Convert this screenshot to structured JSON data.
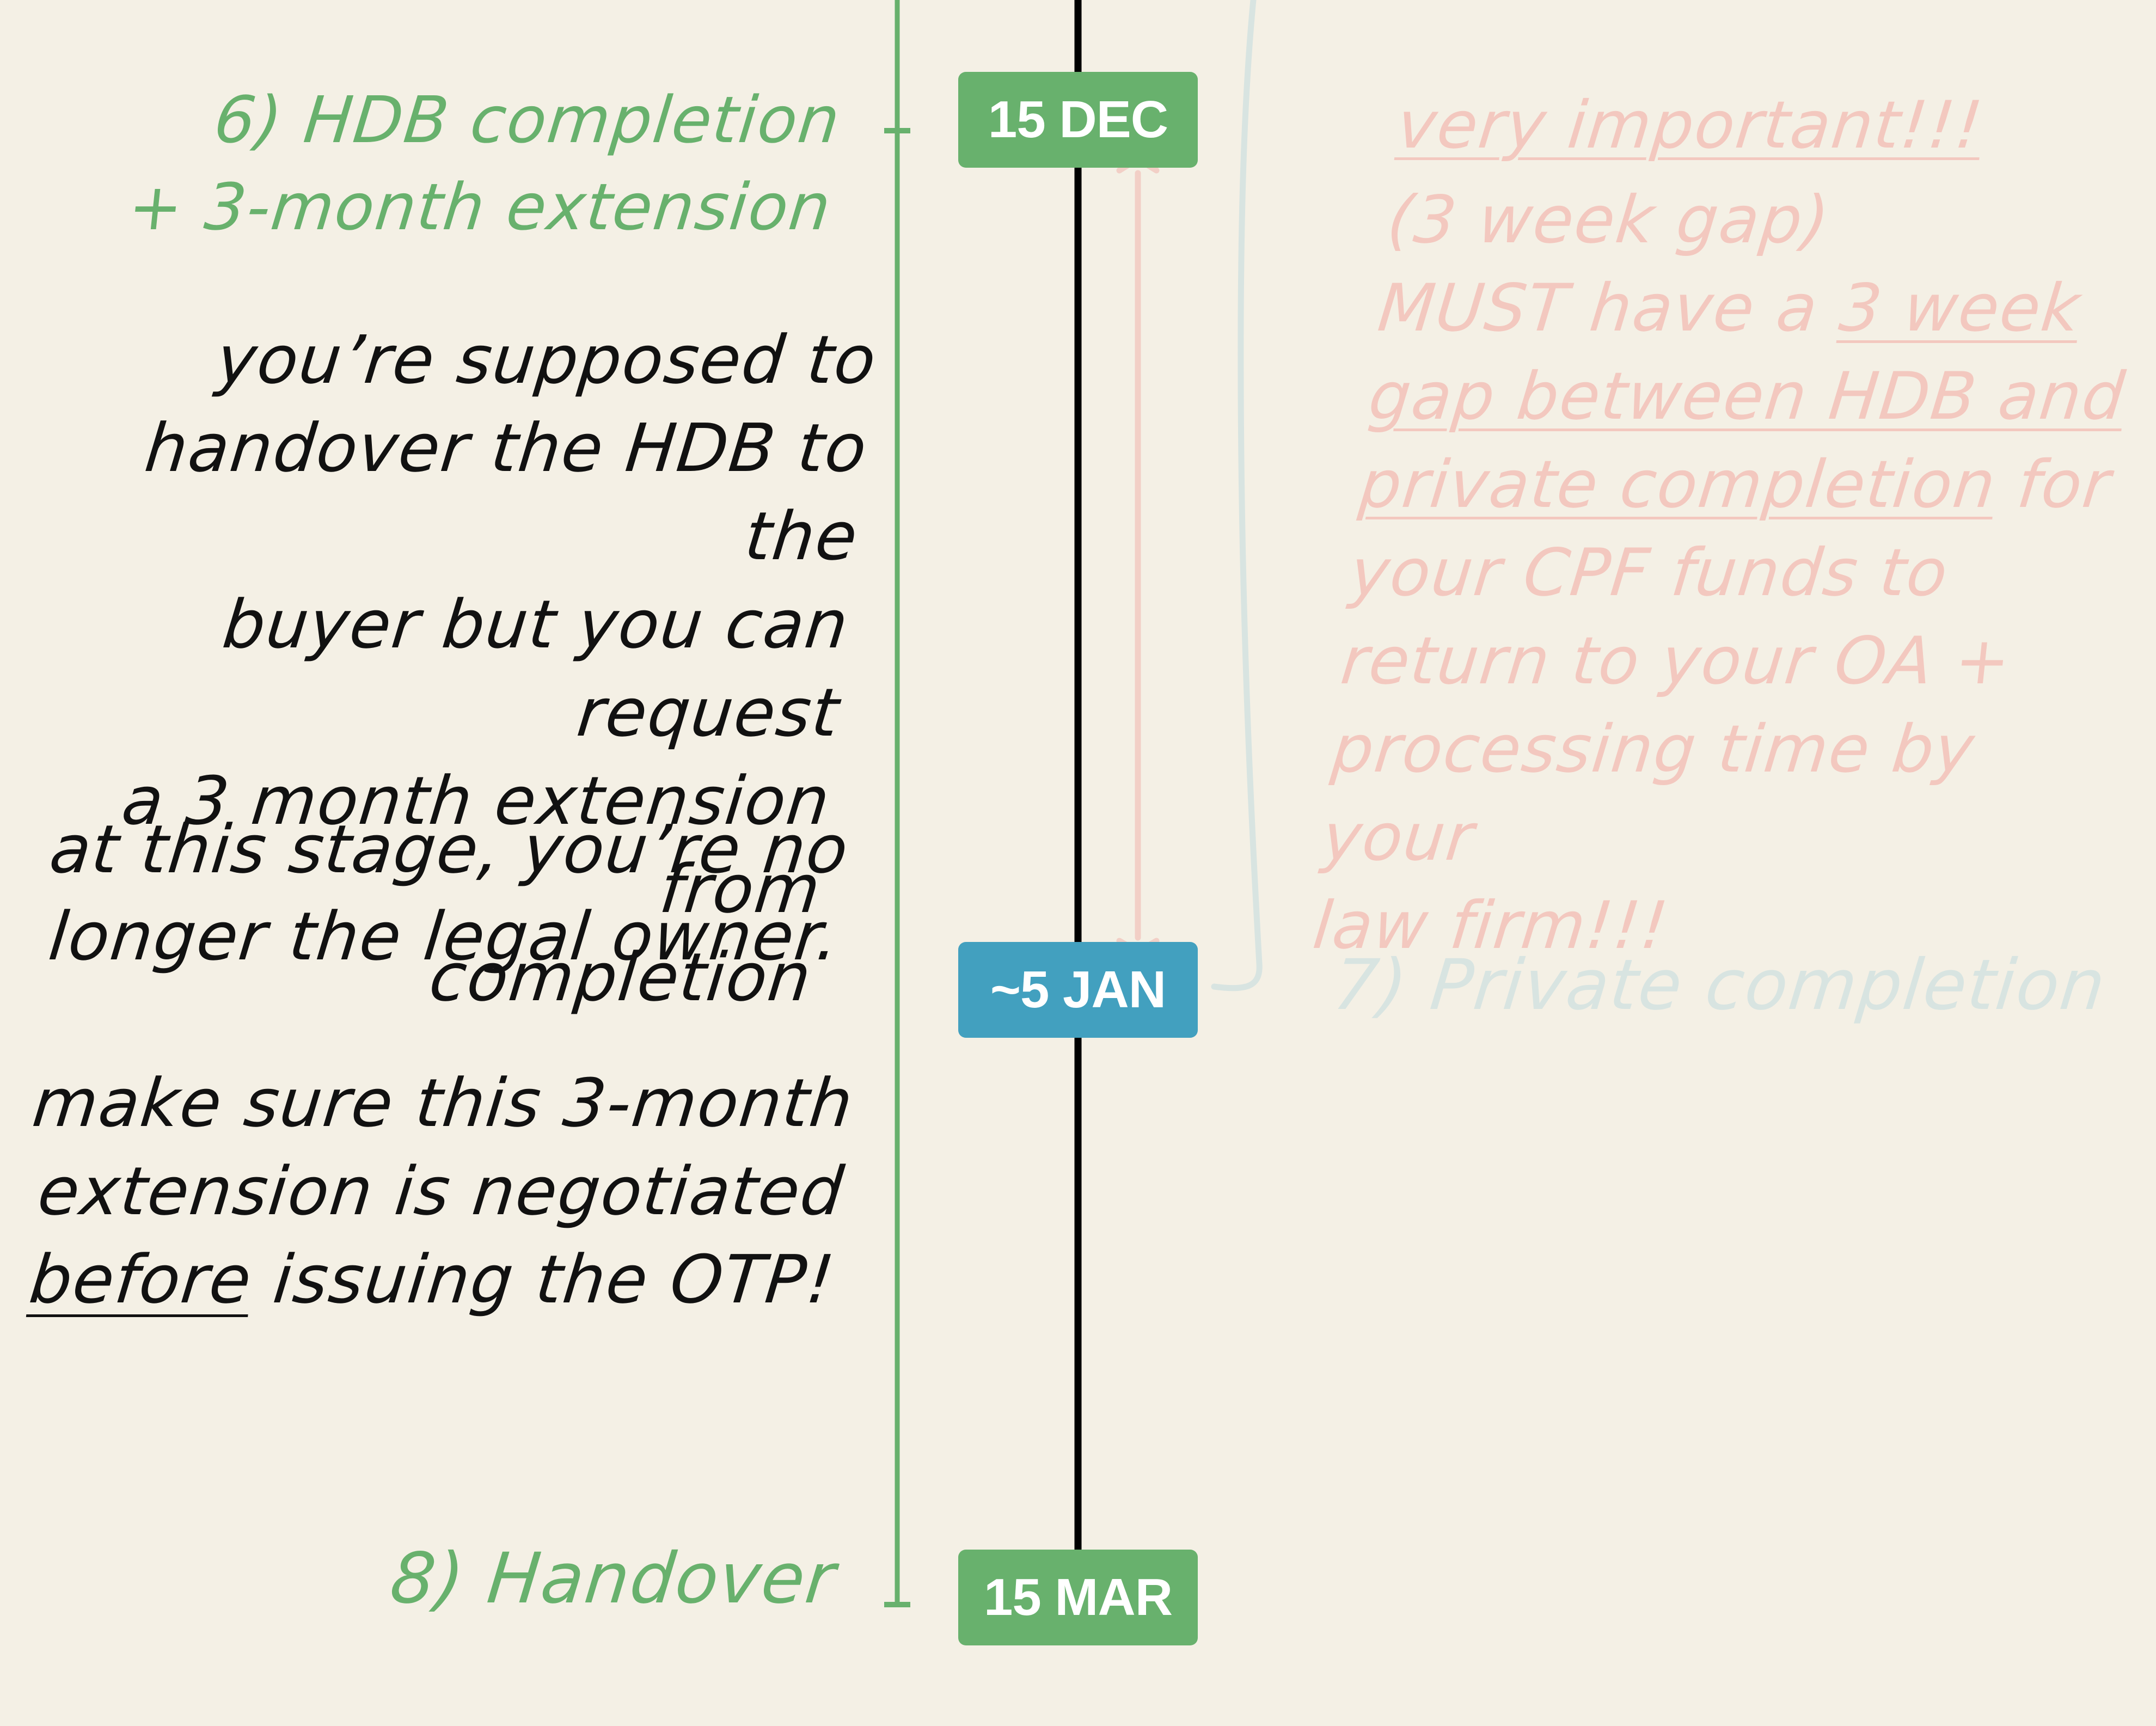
{
  "timeline": {
    "colors": {
      "background": "#F4F0E5",
      "hdb_green": "#68B16D",
      "private_blue": "#42A0BF",
      "warning_pink": "#F3C8BF",
      "faded_bluegray": "#D8E4E1",
      "timeline_black": "#000000"
    },
    "milestones": [
      {
        "step_label_line1": "6) HDB completion",
        "step_label_line2": "+ 3-month extension",
        "date": "15 DEC"
      },
      {
        "step_label": "7) Private completion",
        "date": "~5 JAN"
      },
      {
        "step_label": "8) Handover",
        "date": "15 MAR"
      }
    ],
    "notes_left": {
      "handover": [
        "you’re supposed to",
        "handover the HDB to the",
        "buyer but you can request",
        "a 3 month extension from",
        "completion"
      ],
      "owner": [
        "at this stage, you’re no",
        "longer the legal owner."
      ],
      "negotiate": {
        "line1": "make sure this 3-month",
        "line2": "extension is negotiated",
        "line3_underlined": "before",
        "line3_rest": " issuing the OTP!"
      }
    },
    "notes_right": {
      "heading": "very important!!!",
      "gap_label": "(3 week gap)",
      "must_prefix": "MUST have a ",
      "must_underlined_1": "3 week",
      "must_underlined_2": "gap between HDB and",
      "must_underlined_3": "private completion",
      "must_rest_3": " for",
      "line4": "your CPF funds to",
      "line5": "return to your OA +",
      "line6": "processing time by your",
      "line7": "law firm!!!"
    }
  }
}
